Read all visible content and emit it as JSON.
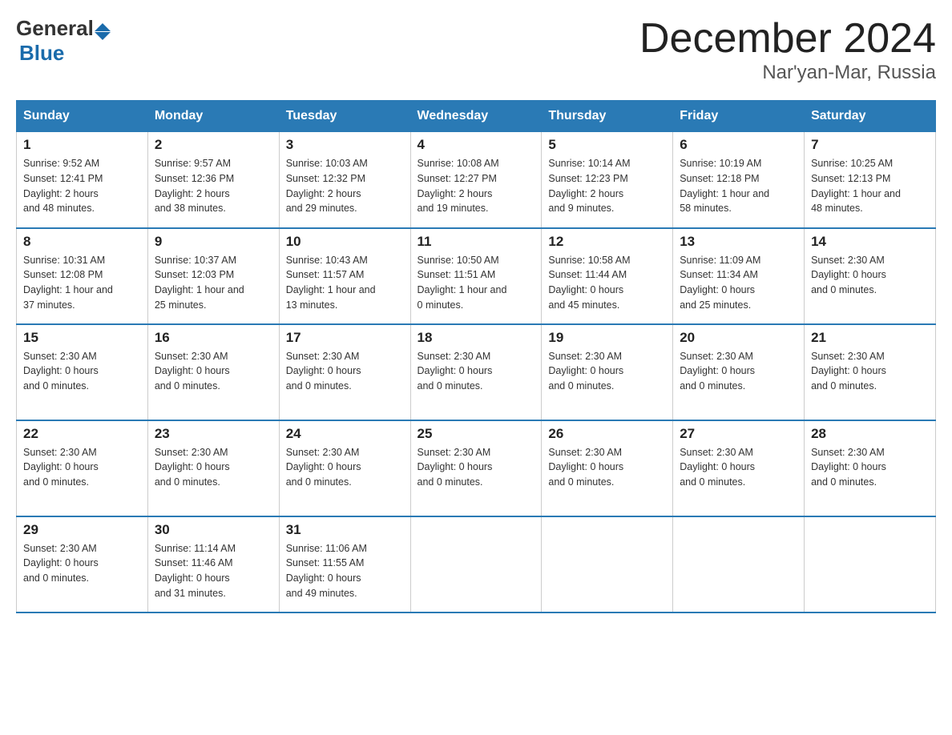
{
  "header": {
    "month_year": "December 2024",
    "location": "Nar'yan-Mar, Russia",
    "logo_general": "General",
    "logo_blue": "Blue"
  },
  "days_of_week": [
    "Sunday",
    "Monday",
    "Tuesday",
    "Wednesday",
    "Thursday",
    "Friday",
    "Saturday"
  ],
  "weeks": [
    [
      {
        "day": "1",
        "info": "Sunrise: 9:52 AM\nSunset: 12:41 PM\nDaylight: 2 hours\nand 48 minutes."
      },
      {
        "day": "2",
        "info": "Sunrise: 9:57 AM\nSunset: 12:36 PM\nDaylight: 2 hours\nand 38 minutes."
      },
      {
        "day": "3",
        "info": "Sunrise: 10:03 AM\nSunset: 12:32 PM\nDaylight: 2 hours\nand 29 minutes."
      },
      {
        "day": "4",
        "info": "Sunrise: 10:08 AM\nSunset: 12:27 PM\nDaylight: 2 hours\nand 19 minutes."
      },
      {
        "day": "5",
        "info": "Sunrise: 10:14 AM\nSunset: 12:23 PM\nDaylight: 2 hours\nand 9 minutes."
      },
      {
        "day": "6",
        "info": "Sunrise: 10:19 AM\nSunset: 12:18 PM\nDaylight: 1 hour and\n58 minutes."
      },
      {
        "day": "7",
        "info": "Sunrise: 10:25 AM\nSunset: 12:13 PM\nDaylight: 1 hour and\n48 minutes."
      }
    ],
    [
      {
        "day": "8",
        "info": "Sunrise: 10:31 AM\nSunset: 12:08 PM\nDaylight: 1 hour and\n37 minutes."
      },
      {
        "day": "9",
        "info": "Sunrise: 10:37 AM\nSunset: 12:03 PM\nDaylight: 1 hour and\n25 minutes."
      },
      {
        "day": "10",
        "info": "Sunrise: 10:43 AM\nSunset: 11:57 AM\nDaylight: 1 hour and\n13 minutes."
      },
      {
        "day": "11",
        "info": "Sunrise: 10:50 AM\nSunset: 11:51 AM\nDaylight: 1 hour and\n0 minutes."
      },
      {
        "day": "12",
        "info": "Sunrise: 10:58 AM\nSunset: 11:44 AM\nDaylight: 0 hours\nand 45 minutes."
      },
      {
        "day": "13",
        "info": "Sunrise: 11:09 AM\nSunset: 11:34 AM\nDaylight: 0 hours\nand 25 minutes."
      },
      {
        "day": "14",
        "info": "Sunset: 2:30 AM\nDaylight: 0 hours\nand 0 minutes."
      }
    ],
    [
      {
        "day": "15",
        "info": "Sunset: 2:30 AM\nDaylight: 0 hours\nand 0 minutes."
      },
      {
        "day": "16",
        "info": "Sunset: 2:30 AM\nDaylight: 0 hours\nand 0 minutes."
      },
      {
        "day": "17",
        "info": "Sunset: 2:30 AM\nDaylight: 0 hours\nand 0 minutes."
      },
      {
        "day": "18",
        "info": "Sunset: 2:30 AM\nDaylight: 0 hours\nand 0 minutes."
      },
      {
        "day": "19",
        "info": "Sunset: 2:30 AM\nDaylight: 0 hours\nand 0 minutes."
      },
      {
        "day": "20",
        "info": "Sunset: 2:30 AM\nDaylight: 0 hours\nand 0 minutes."
      },
      {
        "day": "21",
        "info": "Sunset: 2:30 AM\nDaylight: 0 hours\nand 0 minutes."
      }
    ],
    [
      {
        "day": "22",
        "info": "Sunset: 2:30 AM\nDaylight: 0 hours\nand 0 minutes."
      },
      {
        "day": "23",
        "info": "Sunset: 2:30 AM\nDaylight: 0 hours\nand 0 minutes."
      },
      {
        "day": "24",
        "info": "Sunset: 2:30 AM\nDaylight: 0 hours\nand 0 minutes."
      },
      {
        "day": "25",
        "info": "Sunset: 2:30 AM\nDaylight: 0 hours\nand 0 minutes."
      },
      {
        "day": "26",
        "info": "Sunset: 2:30 AM\nDaylight: 0 hours\nand 0 minutes."
      },
      {
        "day": "27",
        "info": "Sunset: 2:30 AM\nDaylight: 0 hours\nand 0 minutes."
      },
      {
        "day": "28",
        "info": "Sunset: 2:30 AM\nDaylight: 0 hours\nand 0 minutes."
      }
    ],
    [
      {
        "day": "29",
        "info": "Sunset: 2:30 AM\nDaylight: 0 hours\nand 0 minutes."
      },
      {
        "day": "30",
        "info": "Sunrise: 11:14 AM\nSunset: 11:46 AM\nDaylight: 0 hours\nand 31 minutes."
      },
      {
        "day": "31",
        "info": "Sunrise: 11:06 AM\nSunset: 11:55 AM\nDaylight: 0 hours\nand 49 minutes."
      },
      {
        "day": "",
        "info": ""
      },
      {
        "day": "",
        "info": ""
      },
      {
        "day": "",
        "info": ""
      },
      {
        "day": "",
        "info": ""
      }
    ]
  ]
}
